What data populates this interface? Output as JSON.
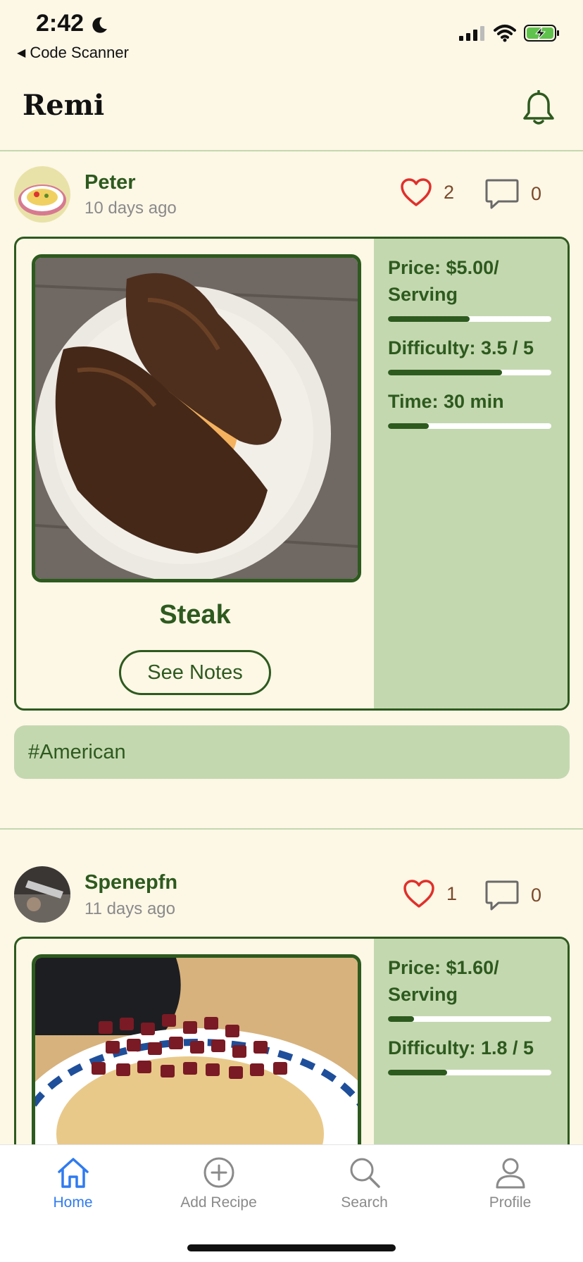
{
  "status": {
    "time": "2:42",
    "back_app": "Code Scanner"
  },
  "header": {
    "title": "Remi"
  },
  "posts": [
    {
      "user": "Peter",
      "time_ago": "10 days ago",
      "likes": "2",
      "comments": "0",
      "recipe_name": "Steak",
      "notes_label": "See Notes",
      "metrics": [
        {
          "label": "Price: $5.00/ Serving",
          "value": 0.5
        },
        {
          "label": "Difficulty: 3.5 / 5",
          "value": 0.7
        },
        {
          "label": "Time: 30 min",
          "value": 0.25
        }
      ],
      "tag": "#American"
    },
    {
      "user": "Spenepfn",
      "time_ago": "11 days ago",
      "likes": "1",
      "comments": "0",
      "metrics": [
        {
          "label": "Price: $1.60/ Serving",
          "value": 0.16
        },
        {
          "label": "Difficulty: 1.8 / 5",
          "value": 0.36
        }
      ]
    }
  ],
  "tabs": [
    {
      "label": "Home",
      "icon": "home-icon",
      "active": true
    },
    {
      "label": "Add Recipe",
      "icon": "add-circle-icon",
      "active": false
    },
    {
      "label": "Search",
      "icon": "search-icon",
      "active": false
    },
    {
      "label": "Profile",
      "icon": "profile-icon",
      "active": false
    }
  ],
  "colors": {
    "accent": "#2d5a1e",
    "panel": "#c4d8b0",
    "background": "#fdf7e6",
    "like": "#e0302a",
    "active_tab": "#2f7bf0"
  }
}
